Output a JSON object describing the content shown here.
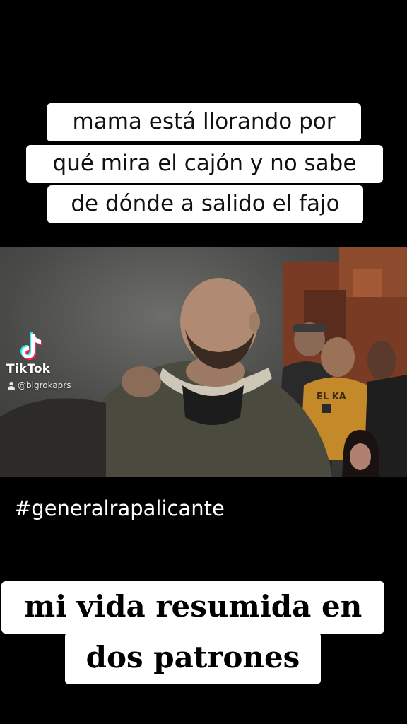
{
  "top_caption": {
    "lines": [
      "mama está llorando por",
      "qué mira el cajón y no sabe",
      "de dónde a salido el fajo"
    ]
  },
  "video": {
    "watermark": {
      "brand": "TikTok",
      "username": "@bigrokaprs",
      "logo_icon": "tiktok-note-icon",
      "user_icon": "person-icon"
    },
    "shirt_text": "EL KA"
  },
  "hashtag": "#generalrapalicante",
  "bottom_caption": {
    "lines": [
      "mi vida resumida en",
      "dos patrones"
    ]
  },
  "colors": {
    "background": "#000000",
    "caption_bg": "#ffffff",
    "tiktok_cyan": "#25f4ee",
    "tiktok_red": "#fe2c55"
  }
}
